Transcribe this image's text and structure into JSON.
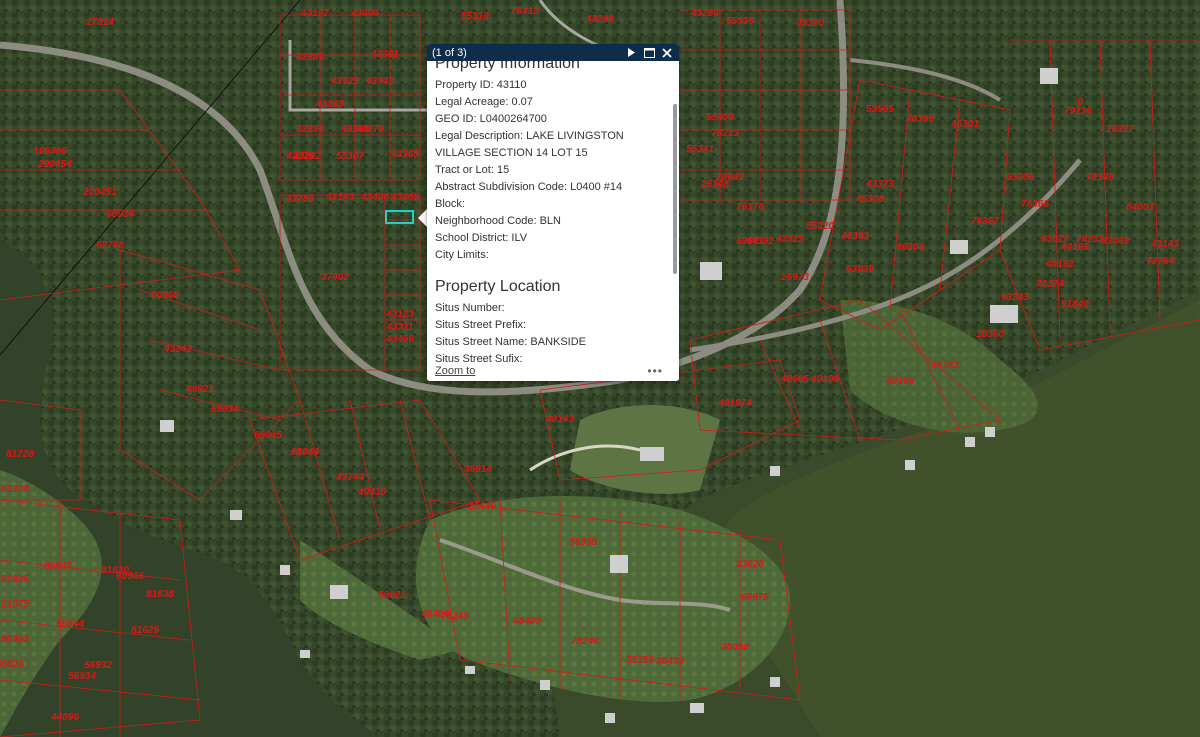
{
  "colors": {
    "parcel_line": "#d81818",
    "selection": "#19d3c5",
    "popup_header": "#0d2d4a",
    "water": "#2e3f22",
    "land": "#3a4a2c"
  },
  "popup": {
    "counter": "(1 of 3)",
    "icons": [
      "next-arrow-icon",
      "maximize-icon",
      "close-icon"
    ],
    "sections": [
      {
        "title": "Property Information",
        "fields": [
          {
            "label": "Property ID:",
            "value": "43110"
          },
          {
            "label": "Legal Acreage:",
            "value": "0.07"
          },
          {
            "label": "GEO ID:",
            "value": "L0400264700"
          },
          {
            "label": "Legal Description:",
            "value": "LAKE LIVINGSTON VILLAGE SECTION 14 LOT 15"
          },
          {
            "label": "Tract or Lot:",
            "value": "15"
          },
          {
            "label": "Abstract Subdivision Code:",
            "value": "L0400 #14"
          },
          {
            "label": "Block:",
            "value": ""
          },
          {
            "label": "Neighborhood Code:",
            "value": "BLN"
          },
          {
            "label": "School District:",
            "value": "ILV"
          },
          {
            "label": "City Limits:",
            "value": ""
          }
        ]
      },
      {
        "title": "Property Location",
        "fields": [
          {
            "label": "Situs Number:",
            "value": ""
          },
          {
            "label": "Situs Street Prefix:",
            "value": ""
          },
          {
            "label": "Situs Street Name:",
            "value": "BANKSIDE"
          },
          {
            "label": "Situs Street Sufix:",
            "value": ""
          }
        ]
      }
    ],
    "zoom_label": "Zoom to",
    "more_label": "•••"
  },
  "parcels": [
    "17914",
    "43197",
    "43404",
    "55310",
    "78418",
    "43288",
    "43286",
    "55336",
    "43320",
    "43289",
    "43301",
    "43322",
    "43342",
    "43290",
    "43299",
    "43270",
    "43278",
    "43368",
    "43262",
    "55307",
    "43268",
    "43280",
    "43193",
    "43406",
    "43311",
    "43466",
    "43469",
    "37402",
    "43123",
    "196896",
    "200454",
    "200451",
    "66934",
    "62768",
    "80868",
    "43242",
    "89921",
    "69638",
    "68945",
    "65944",
    "43744",
    "49430",
    "81728",
    "81229",
    "80947",
    "60946",
    "81630",
    "81635",
    "81638",
    "56944",
    "90943",
    "56926",
    "56932",
    "56934",
    "81675",
    "81629",
    "44096",
    "68021",
    "55309",
    "78213",
    "76376",
    "55341",
    "26348",
    "78942",
    "44392",
    "26973",
    "55320",
    "53941",
    "43325",
    "45308",
    "43373",
    "53939",
    "40396",
    "46301",
    "53965",
    "40393",
    "46304",
    "55306",
    "76367",
    "76366",
    "83022",
    "44192",
    "44195",
    "76374",
    "79232",
    "83049",
    "43143",
    "78764",
    "91840",
    "84003",
    "63044",
    "40196",
    "40196",
    "401974",
    "40143",
    "40143",
    "38438",
    "48404",
    "56958",
    "38614",
    "68975",
    "78246",
    "48403",
    "55359",
    "38090",
    "78249",
    "93020",
    "25449",
    "48605",
    "63243",
    "79136",
    "10360",
    "0",
    "78146",
    "16327",
    "44196",
    "47143"
  ],
  "parcel_subset_shown": true
}
